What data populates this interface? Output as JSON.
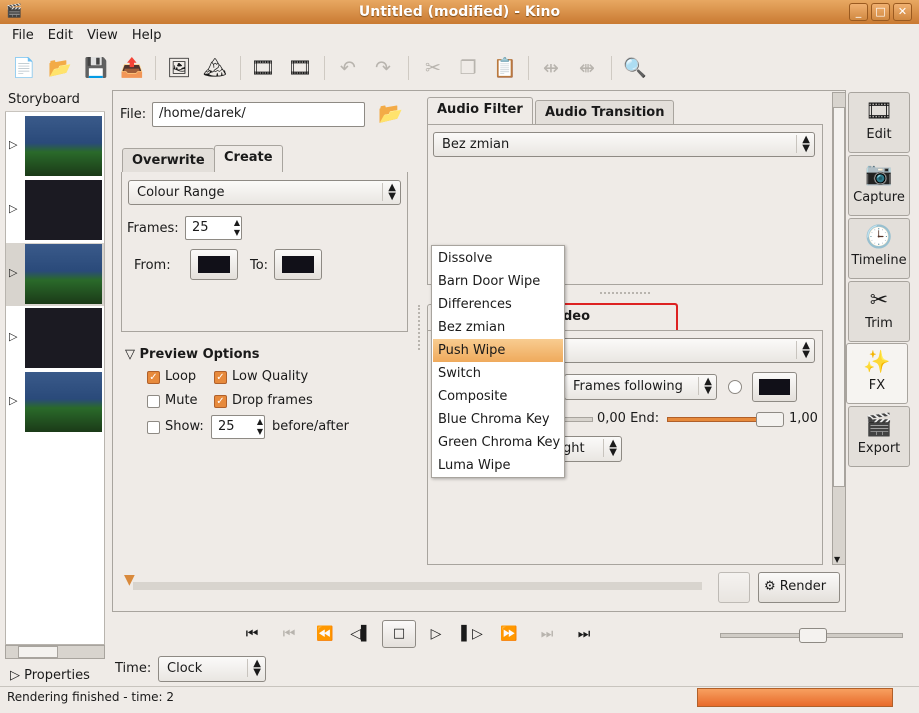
{
  "window": {
    "title": "Untitled (modified)  - Kino"
  },
  "menu": [
    "File",
    "Edit",
    "View",
    "Help"
  ],
  "storyboard": {
    "label": "Storyboard",
    "properties": "Properties"
  },
  "file": {
    "label": "File:",
    "value": "/home/darek/"
  },
  "left_tabs": {
    "overwrite": "Overwrite",
    "create": "Create"
  },
  "create": {
    "generator": "Colour Range",
    "frames_label": "Frames:",
    "frames": "25",
    "from": "From:",
    "to": "To:"
  },
  "preview": {
    "title": "Preview Options",
    "loop": "Loop",
    "low_quality": "Low Quality",
    "mute": "Mute",
    "drop_frames": "Drop frames",
    "show": "Show:",
    "show_value": "25",
    "before_after": "before/after",
    "checked": {
      "loop": true,
      "low_quality": true,
      "mute": false,
      "drop_frames": true,
      "show": false
    }
  },
  "audio_tabs": {
    "filter": "Audio Filter",
    "transition": "Audio Transition"
  },
  "audio_filter": "Bez zmian",
  "video": {
    "tab": "deo Transition",
    "frames_mode": "Frames following",
    "start_value": "0,00",
    "end_label": "End:",
    "end_value": "1,00",
    "direction": "ght"
  },
  "dropdown": {
    "items": [
      "Dissolve",
      "Barn Door Wipe",
      "Differences",
      "Bez zmian",
      "Push Wipe",
      "Switch",
      "Composite",
      "Blue Chroma Key",
      "Green Chroma Key",
      "Luma Wipe"
    ],
    "selected": "Push Wipe"
  },
  "render_label": "Render",
  "time": {
    "label": "Time:",
    "value": "Clock"
  },
  "status": "Rendering finished - time: 2",
  "render_progress": 1.0,
  "side_buttons": [
    "Edit",
    "Capture",
    "Timeline",
    "Trim",
    "FX",
    "Export"
  ],
  "active_side": "FX",
  "colors": {
    "accent": "#e78a3c",
    "highlight": "#dd2222"
  }
}
